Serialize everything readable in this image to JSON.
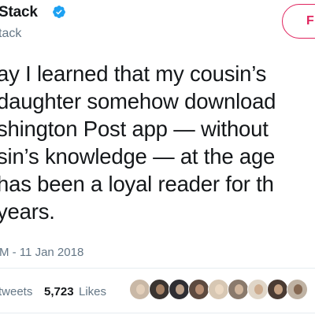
{
  "header": {
    "display_name": "Stack",
    "handle": "tack",
    "follow_label": "F"
  },
  "tweet": {
    "lines": [
      "ay I learned that my cousin’s",
      "daughter somehow download",
      "shington Post app — without",
      "sin’s knowledge — at the age",
      "has been a loyal reader for th",
      "years."
    ],
    "timestamp": "M - 11 Jan 2018"
  },
  "stats": {
    "retweets_label": "tweets",
    "likes_count": "5,723",
    "likes_label": "Likes"
  },
  "avatars": [
    {
      "bg": "#c9b8a6",
      "face": "#e8d2bd"
    },
    {
      "bg": "#3a3430",
      "face": "#b88f6f"
    },
    {
      "bg": "#2e2e33",
      "face": "#d4b49a"
    },
    {
      "bg": "#5d4a3f",
      "face": "#c79a7c"
    },
    {
      "bg": "#d7c7b3",
      "face": "#f0dcc6"
    },
    {
      "bg": "#8a7a6c",
      "face": "#dcc0a4"
    },
    {
      "bg": "#e0d6c8",
      "face": "#c9a585"
    },
    {
      "bg": "#4a3b33",
      "face": "#d9b391"
    },
    {
      "bg": "#bfb2a3",
      "face": "#7a5a44"
    }
  ],
  "colors": {
    "accent": "#e0245e",
    "verified": "#1da1f2",
    "secondary_text": "#657786"
  },
  "icons": {
    "verified": "verified-badge-icon"
  }
}
